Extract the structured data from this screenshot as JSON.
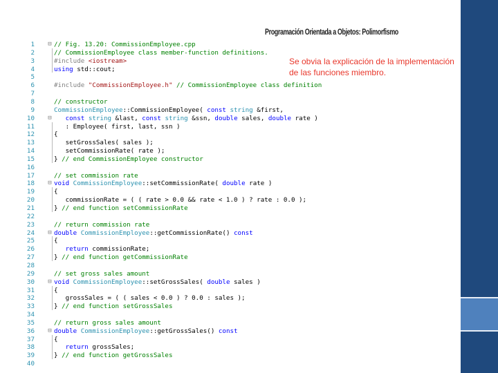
{
  "slide": {
    "title": "Programación Orientada a Objetos: Polimorfismo",
    "note": "Se obvia la explicación de la implementación de las funciones miembro."
  },
  "colors": {
    "accent_dark": "#1f497d",
    "accent_light": "#4f81bd",
    "note_red": "#e8362a",
    "comment_green": "#008000",
    "keyword_blue": "#0000ff",
    "line_number": "#2b91af"
  },
  "editor": {
    "lines": [
      {
        "n": "1",
        "fold": "⊟",
        "segs": [
          {
            "c": "c",
            "t": "// Fig. 13.20: CommissionEmployee.cpp"
          }
        ]
      },
      {
        "n": "2",
        "fold": "",
        "segs": [
          {
            "c": "c",
            "t": "// CommissionEmployee class member-function definitions."
          }
        ]
      },
      {
        "n": "3",
        "fold": "",
        "segs": [
          {
            "c": "p",
            "t": "#include "
          },
          {
            "c": "s",
            "t": "<iostream>"
          }
        ]
      },
      {
        "n": "4",
        "fold": "",
        "segs": [
          {
            "c": "k",
            "t": "using "
          },
          {
            "c": "",
            "t": "std::cout;"
          }
        ]
      },
      {
        "n": "5",
        "fold": "",
        "segs": []
      },
      {
        "n": "6",
        "fold": "",
        "segs": [
          {
            "c": "p",
            "t": "#include "
          },
          {
            "c": "s",
            "t": "\"CommissionEmployee.h\""
          },
          {
            "c": "c",
            "t": " // CommissionEmployee class definition"
          }
        ]
      },
      {
        "n": "7",
        "fold": "",
        "segs": []
      },
      {
        "n": "8",
        "fold": "",
        "segs": [
          {
            "c": "c",
            "t": "// constructor"
          }
        ]
      },
      {
        "n": "9",
        "fold": "",
        "segs": [
          {
            "c": "t",
            "t": "CommissionEmployee"
          },
          {
            "c": "",
            "t": "::CommissionEmployee( "
          },
          {
            "c": "k",
            "t": "const "
          },
          {
            "c": "t",
            "t": "string"
          },
          {
            "c": "",
            "t": " &first,"
          }
        ]
      },
      {
        "n": "10",
        "fold": "⊟",
        "segs": [
          {
            "c": "",
            "t": "   "
          },
          {
            "c": "k",
            "t": "const "
          },
          {
            "c": "t",
            "t": "string"
          },
          {
            "c": "",
            "t": " &last, "
          },
          {
            "c": "k",
            "t": "const "
          },
          {
            "c": "t",
            "t": "string"
          },
          {
            "c": "",
            "t": " &ssn, "
          },
          {
            "c": "k",
            "t": "double "
          },
          {
            "c": "",
            "t": "sales, "
          },
          {
            "c": "k",
            "t": "double "
          },
          {
            "c": "",
            "t": "rate )"
          }
        ]
      },
      {
        "n": "11",
        "fold": "",
        "segs": [
          {
            "c": "",
            "t": "   : Employee( first, last, ssn )"
          }
        ]
      },
      {
        "n": "12",
        "fold": "",
        "segs": [
          {
            "c": "",
            "t": "{"
          }
        ]
      },
      {
        "n": "13",
        "fold": "",
        "segs": [
          {
            "c": "",
            "t": "   setGrossSales( sales );"
          }
        ]
      },
      {
        "n": "14",
        "fold": "",
        "segs": [
          {
            "c": "",
            "t": "   setCommissionRate( rate );"
          }
        ]
      },
      {
        "n": "15",
        "fold": "",
        "segs": [
          {
            "c": "",
            "t": "} "
          },
          {
            "c": "c",
            "t": "// end CommissionEmployee constructor"
          }
        ]
      },
      {
        "n": "16",
        "fold": "",
        "segs": []
      },
      {
        "n": "17",
        "fold": "",
        "segs": [
          {
            "c": "c",
            "t": "// set commission rate"
          }
        ]
      },
      {
        "n": "18",
        "fold": "⊟",
        "segs": [
          {
            "c": "k",
            "t": "void "
          },
          {
            "c": "t",
            "t": "CommissionEmployee"
          },
          {
            "c": "",
            "t": "::setCommissionRate( "
          },
          {
            "c": "k",
            "t": "double "
          },
          {
            "c": "",
            "t": "rate )"
          }
        ]
      },
      {
        "n": "19",
        "fold": "",
        "segs": [
          {
            "c": "",
            "t": "{"
          }
        ]
      },
      {
        "n": "20",
        "fold": "",
        "segs": [
          {
            "c": "",
            "t": "   commissionRate = ( ( rate > 0.0 && rate < 1.0 ) ? rate : 0.0 );"
          }
        ]
      },
      {
        "n": "21",
        "fold": "",
        "segs": [
          {
            "c": "",
            "t": "} "
          },
          {
            "c": "c",
            "t": "// end function setCommissionRate"
          }
        ]
      },
      {
        "n": "22",
        "fold": "",
        "segs": []
      },
      {
        "n": "23",
        "fold": "",
        "segs": [
          {
            "c": "c",
            "t": "// return commission rate"
          }
        ]
      },
      {
        "n": "24",
        "fold": "⊟",
        "segs": [
          {
            "c": "k",
            "t": "double "
          },
          {
            "c": "t",
            "t": "CommissionEmployee"
          },
          {
            "c": "",
            "t": "::getCommissionRate() "
          },
          {
            "c": "k",
            "t": "const"
          }
        ]
      },
      {
        "n": "25",
        "fold": "",
        "segs": [
          {
            "c": "",
            "t": "{"
          }
        ]
      },
      {
        "n": "26",
        "fold": "",
        "segs": [
          {
            "c": "",
            "t": "   "
          },
          {
            "c": "k",
            "t": "return "
          },
          {
            "c": "",
            "t": "commissionRate;"
          }
        ]
      },
      {
        "n": "27",
        "fold": "",
        "segs": [
          {
            "c": "",
            "t": "} "
          },
          {
            "c": "c",
            "t": "// end function getCommissionRate"
          }
        ]
      },
      {
        "n": "28",
        "fold": "",
        "segs": []
      },
      {
        "n": "29",
        "fold": "",
        "segs": [
          {
            "c": "c",
            "t": "// set gross sales amount"
          }
        ]
      },
      {
        "n": "30",
        "fold": "⊟",
        "segs": [
          {
            "c": "k",
            "t": "void "
          },
          {
            "c": "t",
            "t": "CommissionEmployee"
          },
          {
            "c": "",
            "t": "::setGrossSales( "
          },
          {
            "c": "k",
            "t": "double "
          },
          {
            "c": "",
            "t": "sales )"
          }
        ]
      },
      {
        "n": "31",
        "fold": "",
        "segs": [
          {
            "c": "",
            "t": "{"
          }
        ]
      },
      {
        "n": "32",
        "fold": "",
        "segs": [
          {
            "c": "",
            "t": "   grossSales = ( ( sales < 0.0 ) ? 0.0 : sales );"
          }
        ]
      },
      {
        "n": "33",
        "fold": "",
        "segs": [
          {
            "c": "",
            "t": "} "
          },
          {
            "c": "c",
            "t": "// end function setGrossSales"
          }
        ]
      },
      {
        "n": "34",
        "fold": "",
        "segs": []
      },
      {
        "n": "35",
        "fold": "",
        "segs": [
          {
            "c": "c",
            "t": "// return gross sales amount"
          }
        ]
      },
      {
        "n": "36",
        "fold": "⊟",
        "segs": [
          {
            "c": "k",
            "t": "double "
          },
          {
            "c": "t",
            "t": "CommissionEmployee"
          },
          {
            "c": "",
            "t": "::getGrossSales() "
          },
          {
            "c": "k",
            "t": "const"
          }
        ]
      },
      {
        "n": "37",
        "fold": "",
        "segs": [
          {
            "c": "",
            "t": "{"
          }
        ]
      },
      {
        "n": "38",
        "fold": "",
        "segs": [
          {
            "c": "",
            "t": "   "
          },
          {
            "c": "k",
            "t": "return "
          },
          {
            "c": "",
            "t": "grossSales;"
          }
        ]
      },
      {
        "n": "39",
        "fold": "",
        "segs": [
          {
            "c": "",
            "t": "} "
          },
          {
            "c": "c",
            "t": "// end function getGrossSales"
          }
        ]
      },
      {
        "n": "40",
        "fold": "",
        "segs": []
      }
    ]
  }
}
